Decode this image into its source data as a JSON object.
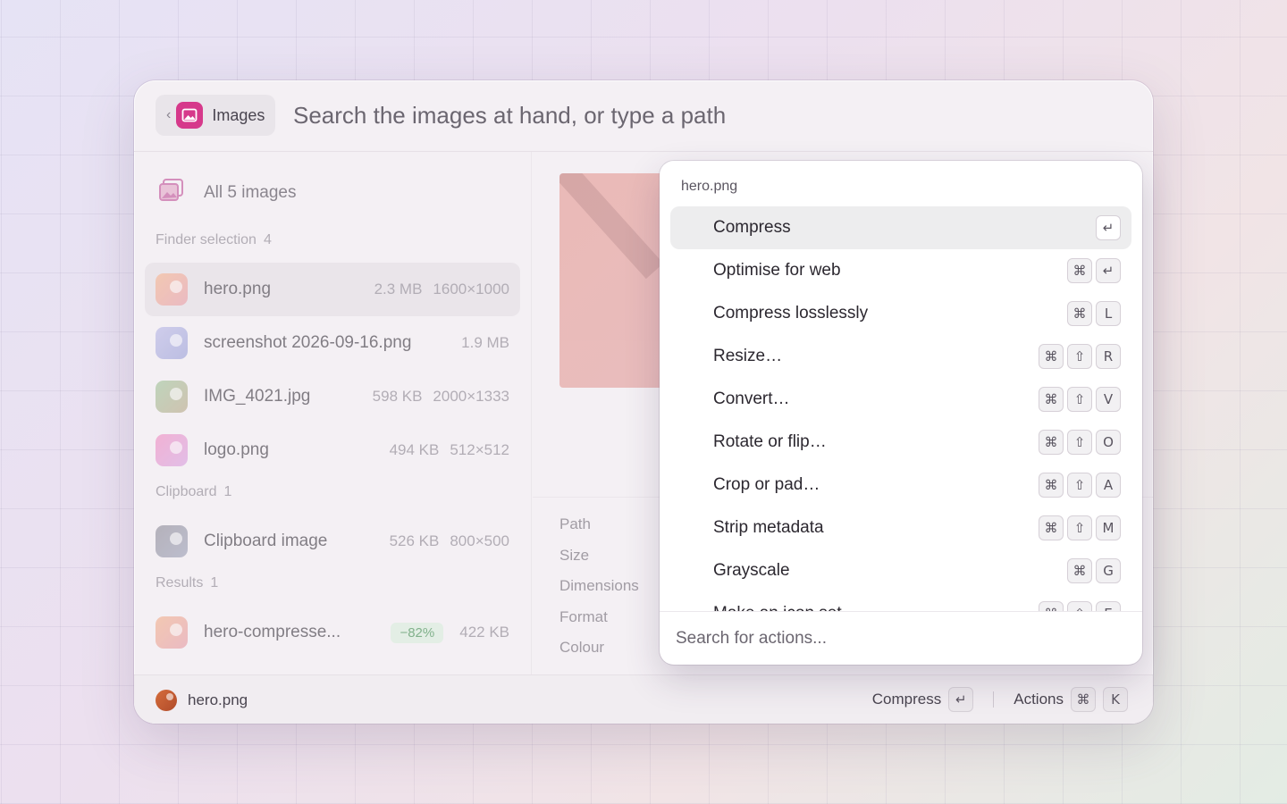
{
  "colors": {
    "accent": "#d6398b",
    "selected_row": "#e4dfe5",
    "badge_green": "#3c8b4c"
  },
  "header": {
    "back_icon": "chevron-left-icon",
    "breadcrumb_label": "Images",
    "search_placeholder": "Search the images at hand, or type a path"
  },
  "sidebar": {
    "all_label": "All 5 images",
    "sections": [
      {
        "title": "Finder selection",
        "count": "4"
      },
      {
        "title": "Clipboard",
        "count": "1"
      },
      {
        "title": "Results",
        "count": "1"
      }
    ],
    "items": [
      {
        "name": "hero.png",
        "size": "2.3 MB",
        "dims": "1600×1000"
      },
      {
        "name": "screenshot 2026-09-16.png",
        "size": "1.9 MB",
        "dims": ""
      },
      {
        "name": "IMG_4021.jpg",
        "size": "598 KB",
        "dims": "2000×1333"
      },
      {
        "name": "logo.png",
        "size": "494 KB",
        "dims": "512×512"
      },
      {
        "name": "Clipboard image",
        "size": "526 KB",
        "dims": "800×500"
      },
      {
        "name": "hero-compresse...",
        "badge": "−82%",
        "size": "422 KB"
      }
    ]
  },
  "details": {
    "labels": [
      "Path",
      "Size",
      "Dimensions",
      "Format",
      "Colour"
    ]
  },
  "actions_menu": {
    "title": "hero.png",
    "items": [
      {
        "label": "Compress",
        "keys": [
          "↵"
        ]
      },
      {
        "label": "Optimise for web",
        "keys": [
          "⌘",
          "↵"
        ]
      },
      {
        "label": "Compress losslessly",
        "keys": [
          "⌘",
          "L"
        ]
      },
      {
        "label": "Resize…",
        "keys": [
          "⌘",
          "⇧",
          "R"
        ]
      },
      {
        "label": "Convert…",
        "keys": [
          "⌘",
          "⇧",
          "V"
        ]
      },
      {
        "label": "Rotate or flip…",
        "keys": [
          "⌘",
          "⇧",
          "O"
        ]
      },
      {
        "label": "Crop or pad…",
        "keys": [
          "⌘",
          "⇧",
          "A"
        ]
      },
      {
        "label": "Strip metadata",
        "keys": [
          "⌘",
          "⇧",
          "M"
        ]
      },
      {
        "label": "Grayscale",
        "keys": [
          "⌘",
          "G"
        ]
      },
      {
        "label": "Make an icon set…",
        "keys": [
          "⌘",
          "⇧",
          "E"
        ]
      }
    ],
    "search_placeholder": "Search for actions..."
  },
  "footer": {
    "file_name": "hero.png",
    "primary_label": "Compress",
    "primary_key": "↵",
    "actions_label": "Actions",
    "actions_keys": [
      "⌘",
      "K"
    ]
  }
}
